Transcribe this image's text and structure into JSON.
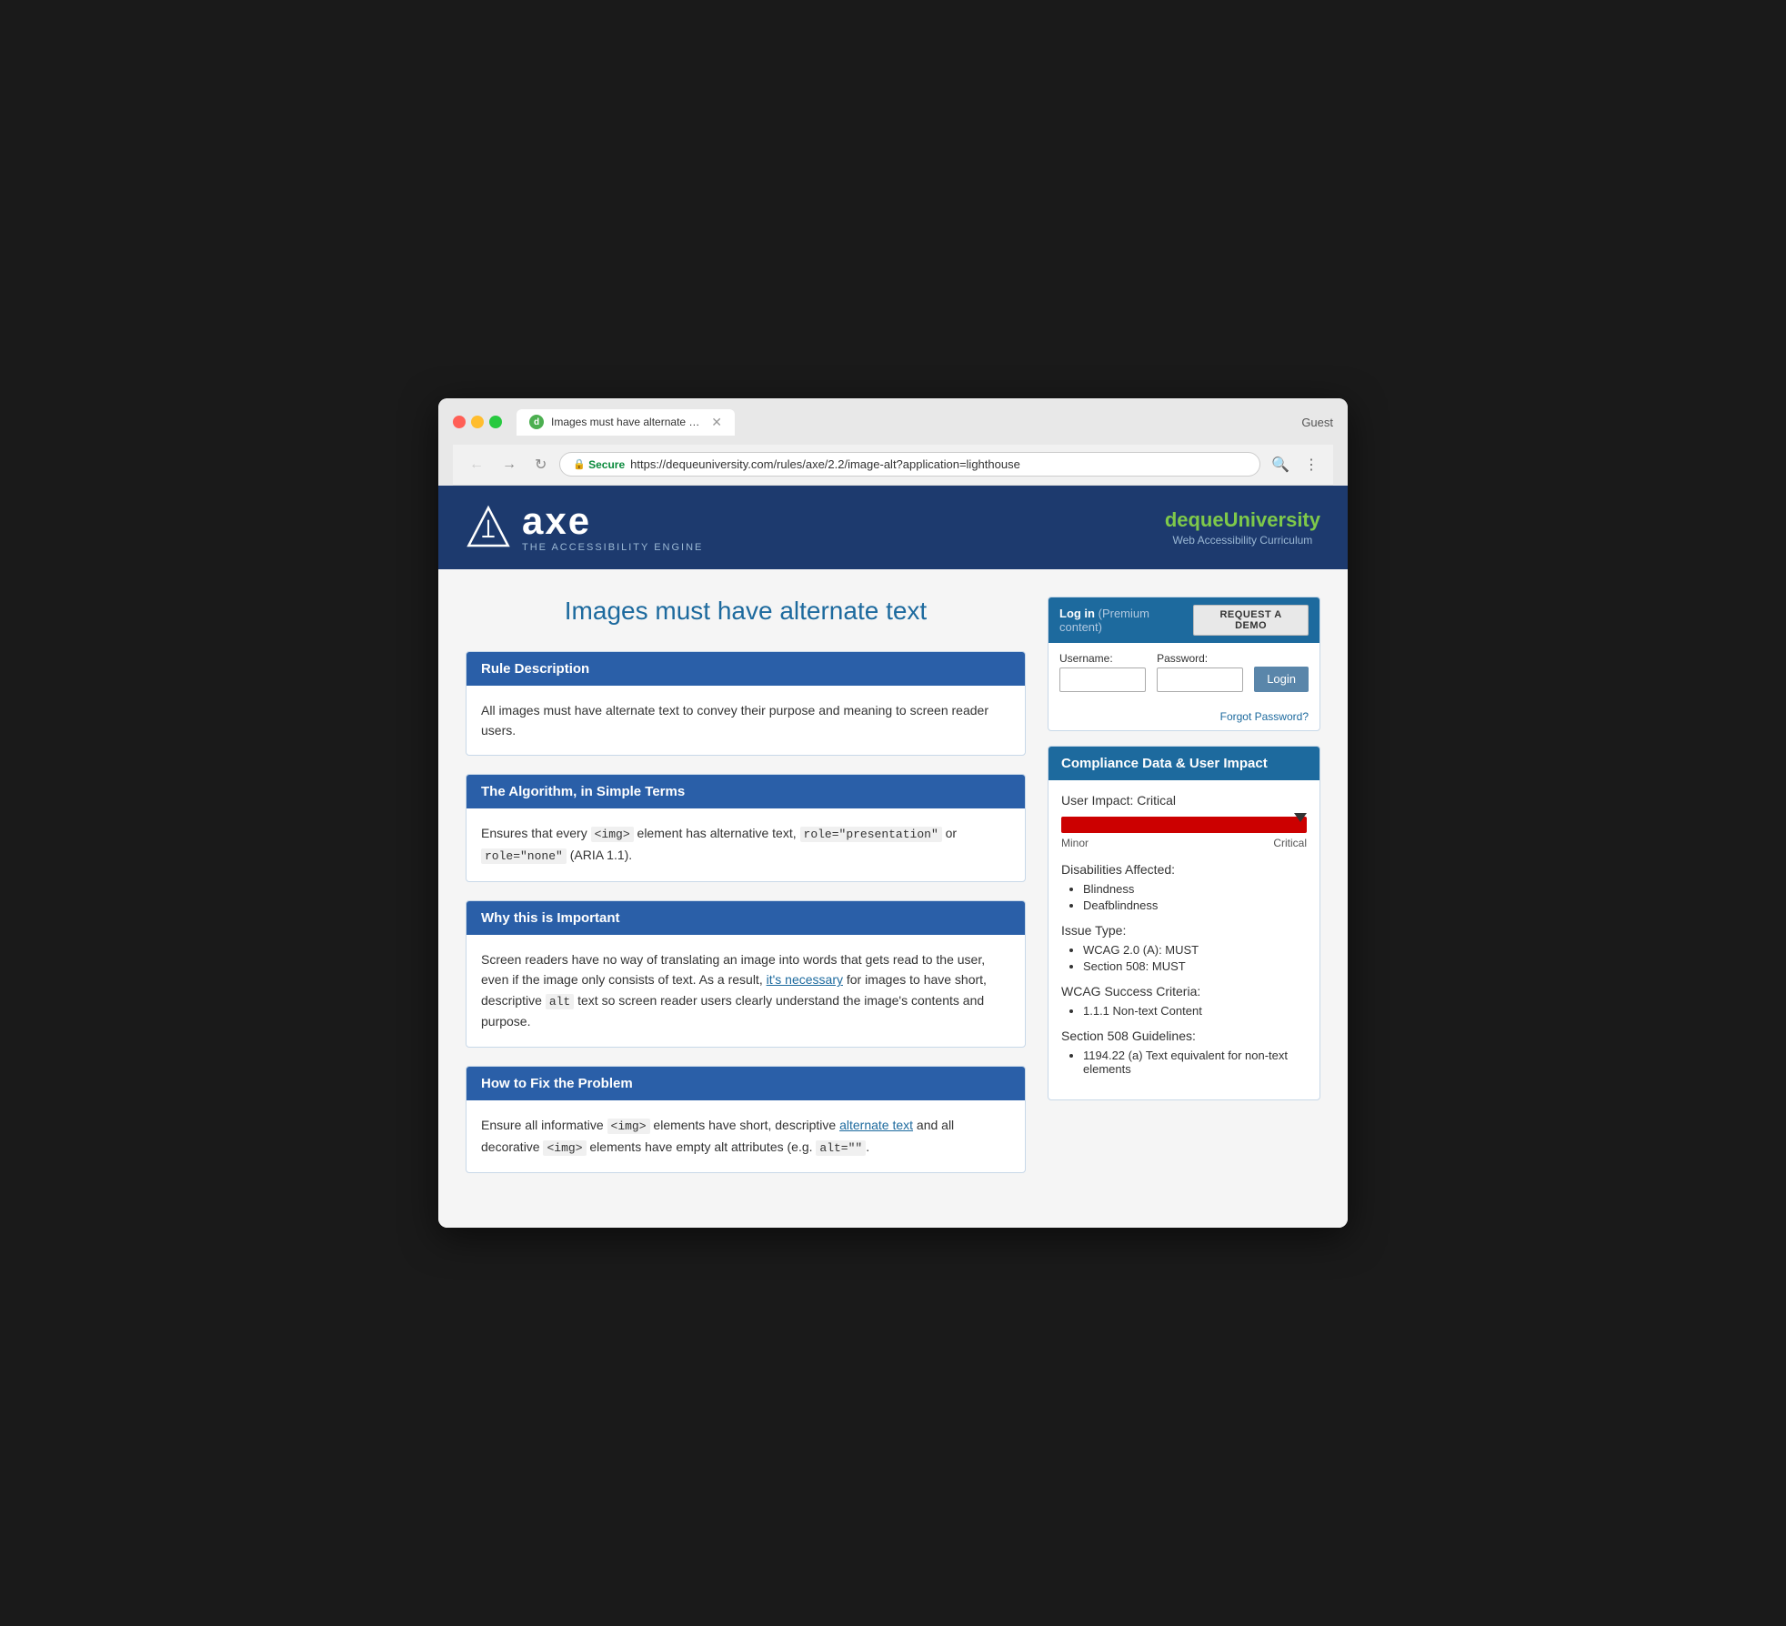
{
  "browser": {
    "tab_title": "Images must have alternate te…",
    "guest_label": "Guest",
    "secure_label": "Secure",
    "url": "https://dequeuniversity.com/rules/axe/2.2/image-alt?application=lighthouse",
    "url_prefix": "https://",
    "url_domain": "dequeuniversity.com",
    "url_path": "/rules/axe/2.2/image-alt?application=lighthouse"
  },
  "site_header": {
    "logo_alt": "axe - The Accessibility Engine",
    "axe_name": "axe",
    "tagline": "THE ACCESSIBILITY ENGINE",
    "deque_name_prefix": "deque",
    "deque_name_suffix": "University",
    "curriculum": "Web Accessibility Curriculum"
  },
  "page": {
    "title": "Images must have alternate text"
  },
  "login": {
    "header_text": "Log in",
    "premium_text": "(Premium content)",
    "request_demo_label": "REQUEST A DEMO",
    "username_label": "Username:",
    "password_label": "Password:",
    "login_button": "Login",
    "forgot_password": "Forgot Password?"
  },
  "compliance": {
    "header": "Compliance Data & User Impact",
    "user_impact_label": "User Impact: Critical",
    "impact_min_label": "Minor",
    "impact_max_label": "Critical",
    "disabilities_label": "Disabilities Affected:",
    "disabilities": [
      "Blindness",
      "Deafblindness"
    ],
    "issue_type_label": "Issue Type:",
    "issue_types": [
      "WCAG 2.0 (A): MUST",
      "Section 508: MUST"
    ],
    "wcag_label": "WCAG Success Criteria:",
    "wcag_items": [
      "1.1.1 Non-text Content"
    ],
    "section508_label": "Section 508 Guidelines:",
    "section508_items": [
      "1194.22 (a) Text equivalent for non-text elements"
    ]
  },
  "sections": [
    {
      "id": "rule-description",
      "header": "Rule Description",
      "body": "All images must have alternate text to convey their purpose and meaning to screen reader users."
    },
    {
      "id": "algorithm",
      "header": "The Algorithm, in Simple Terms",
      "body_html": "Ensures that every <code>&lt;img&gt;</code> element has alternative text, <code>role=\"presentation\"</code> or <code>role=\"none\"</code> (ARIA 1.1)."
    },
    {
      "id": "why-important",
      "header": "Why this is Important",
      "body_html": "Screen readers have no way of translating an image into words that gets read to the user, even if the image only consists of text. As a result, it's necessary for images to have short, descriptive <code>alt</code> text so screen reader users clearly understand the image's contents and purpose."
    },
    {
      "id": "how-to-fix",
      "header": "How to Fix the Problem",
      "body_html": "Ensure all informative <code>&lt;img&gt;</code> elements have short, descriptive alternate text and all decorative <code>&lt;img&gt;</code> elements have empty alt attributes (e.g. <code>alt=\"\"</code>."
    }
  ]
}
